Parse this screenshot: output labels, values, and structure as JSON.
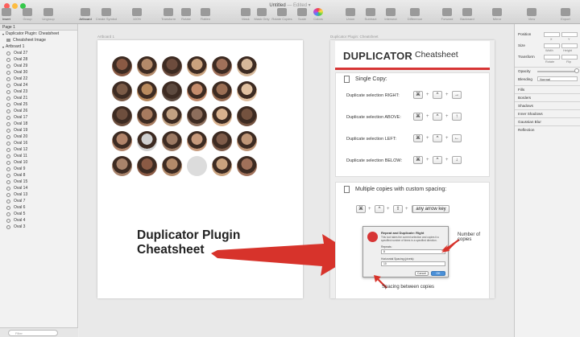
{
  "window": {
    "title": "Untitled",
    "edited": "— Edited ▾",
    "traffic_colors": [
      "#fc605c",
      "#fdbc40",
      "#34c84a"
    ]
  },
  "toolbar": {
    "items": [
      {
        "label": "Insert",
        "icon": "plus-icon"
      },
      {
        "label": "Group",
        "icon": "group-icon"
      },
      {
        "label": "Ungroup",
        "icon": "ungroup-icon"
      },
      {
        "label": "Artboard",
        "icon": "artboard-icon"
      },
      {
        "label": "Create Symbol",
        "icon": "symbol-icon"
      },
      {
        "label": "100%",
        "icon": "zoom-icon"
      },
      {
        "label": "Transform",
        "icon": "transform-icon"
      },
      {
        "label": "Rotate",
        "icon": "rotate-icon"
      },
      {
        "label": "Flatten",
        "icon": "flatten-icon"
      },
      {
        "label": "Mask",
        "icon": "mask-icon"
      },
      {
        "label": "Mask Only",
        "icon": "mask-only-icon"
      },
      {
        "label": "Rotate Copies",
        "icon": "rotate-copies-icon"
      },
      {
        "label": "Scale",
        "icon": "scale-icon"
      },
      {
        "label": "Colors",
        "icon": "colors-icon"
      },
      {
        "label": "Union",
        "icon": "union-icon"
      },
      {
        "label": "Subtract",
        "icon": "subtract-icon"
      },
      {
        "label": "Intersect",
        "icon": "intersect-icon"
      },
      {
        "label": "Difference",
        "icon": "difference-icon"
      },
      {
        "label": "Forward",
        "icon": "forward-icon"
      },
      {
        "label": "Backward",
        "icon": "backward-icon"
      },
      {
        "label": "Mirror",
        "icon": "mirror-icon"
      },
      {
        "label": "View",
        "icon": "view-icon"
      },
      {
        "label": "Export",
        "icon": "export-icon"
      }
    ]
  },
  "layers": {
    "page": "Page 1",
    "groups": [
      {
        "label": "Duplicator Plugin: Cheatsheet"
      },
      {
        "label": "Cheatsheet Image"
      },
      {
        "label": "Artboard 1"
      }
    ],
    "ovals": [
      "Oval 27",
      "Oval 28",
      "Oval 29",
      "Oval 30",
      "Oval 22",
      "Oval 24",
      "Oval 23",
      "Oval 21",
      "Oval 25",
      "Oval 26",
      "Oval 17",
      "Oval 18",
      "Oval 19",
      "Oval 20",
      "Oval 16",
      "Oval 12",
      "Oval 11",
      "Oval 10",
      "Oval 9",
      "Oval 8",
      "Oval 15",
      "Oval 14",
      "Oval 13",
      "Oval 7",
      "Oval 6",
      "Oval 5",
      "Oval 4",
      "Oval 3"
    ],
    "filter_placeholder": "Filter"
  },
  "canvas": {
    "artboard1_label": "Artboard 1",
    "artboard2_label": "Duplicator Plugin: Cheatsheet",
    "caption_line1": "Duplicator Plugin",
    "caption_line2": "Cheatsheet",
    "avatar_colors": [
      "#8a5a44",
      "#b38a6a",
      "#6d4c3d",
      "#c9a27e",
      "#a0715a",
      "#d6b89a",
      "#7b5b47",
      "#b88a5e",
      "#5d4a3f",
      "#c48c6c",
      "#9b6f55",
      "#e0c0a0",
      "#6e4f3e",
      "#a77b5f",
      "#c2a182",
      "#8d6e5c",
      "#d9b28f",
      "#74523f",
      "#b1846a",
      "#d0d0d0",
      "#9c7a64",
      "#c79a7c",
      "#7f5c4a",
      "#bf9677",
      "#a8836b"
    ]
  },
  "cheatsheet": {
    "title_bold": "DUPLICATOR",
    "title_light": "Cheatsheet",
    "single_heading": "Single Copy:",
    "rows": [
      {
        "label": "Duplicate selection RIGHT:",
        "keys": [
          "⌘",
          "^",
          "→"
        ]
      },
      {
        "label": "Duplicate selection ABOVE:",
        "keys": [
          "⌘",
          "^",
          "↑"
        ]
      },
      {
        "label": "Duplicate selection LEFT:",
        "keys": [
          "⌘",
          "^",
          "←"
        ]
      },
      {
        "label": "Duplicate selection BELOW:",
        "keys": [
          "⌘",
          "^",
          "↓"
        ]
      }
    ],
    "multi_heading": "Multiple copies with custom spacing:",
    "multi_keys": [
      "⌘",
      "^",
      "⇧",
      "^",
      "any arrow key"
    ],
    "plus": "+",
    "dialog": {
      "title": "Repeat and Duplicate: Right",
      "text": "This tool takes the current selection and copies it a specified number of times in a specified direction.",
      "repeats_label": "Repeats:",
      "repeats_value": "8",
      "spacing_label": "Horizontal Spacing (pixels):",
      "spacing_value": "10",
      "cancel": "Cancel",
      "ok": "OK"
    },
    "annotation_copies_1": "Number of",
    "annotation_copies_2": "copies",
    "annotation_spacing": "Spacing between copies"
  },
  "inspector": {
    "position": "Position",
    "size": "Size",
    "transform": "Transform",
    "x": "X",
    "y": "Y",
    "width": "Width",
    "height": "Height",
    "rotate": "Rotate",
    "flip": "Flip",
    "opacity": "Opacity",
    "blending": "Blending",
    "blending_value": "Normal",
    "sections": [
      "Fills",
      "Borders",
      "Shadows",
      "Inner Shadows",
      "Gaussian Blur",
      "Reflection"
    ]
  },
  "accent": "#d73535"
}
